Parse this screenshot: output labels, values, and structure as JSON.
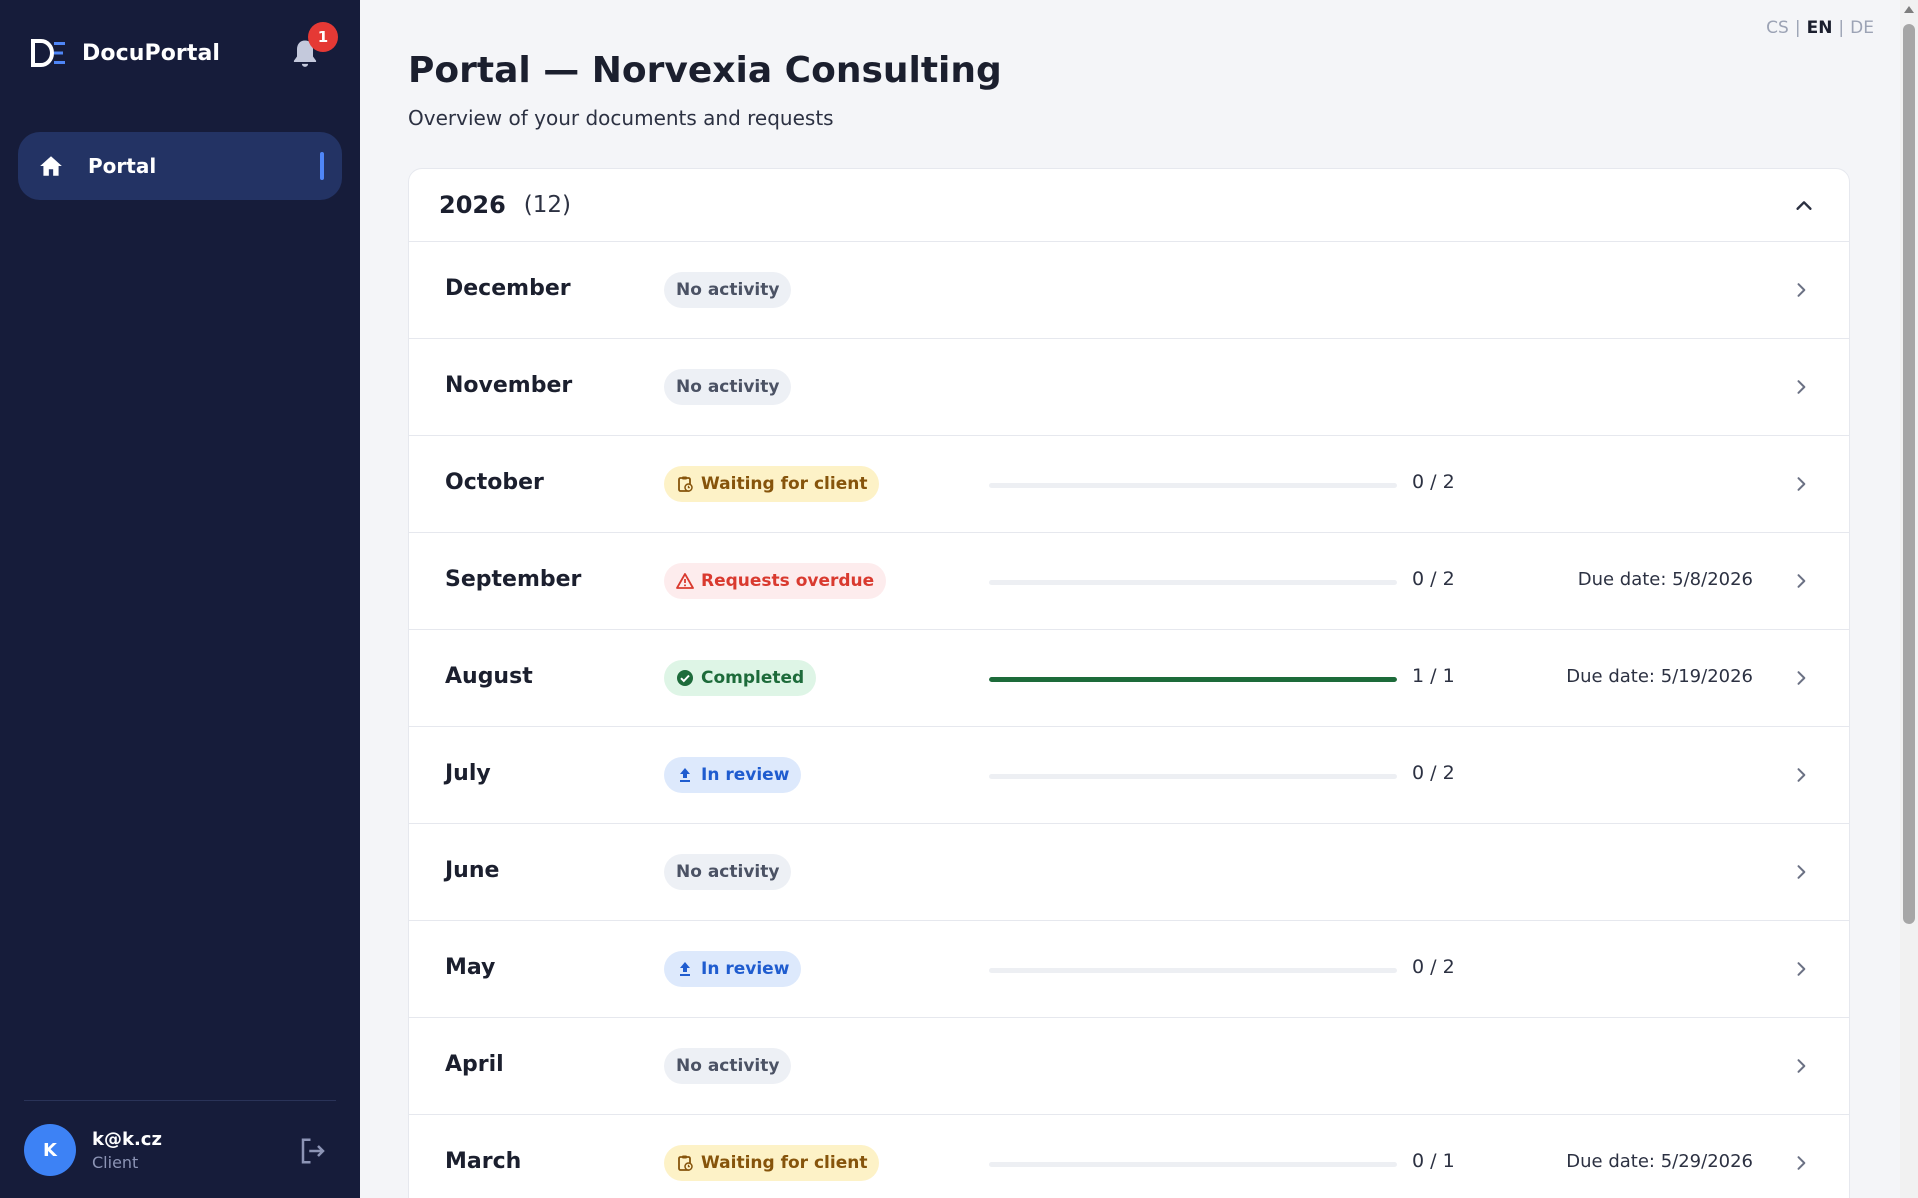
{
  "app": {
    "name": "DocuPortal"
  },
  "notifications": {
    "count": "1"
  },
  "nav": {
    "items": [
      {
        "label": "Portal",
        "icon": "home-icon"
      }
    ]
  },
  "user": {
    "initial": "K",
    "email": "k@k.cz",
    "role": "Client"
  },
  "languages": [
    {
      "code": "CS",
      "active": false
    },
    {
      "code": "EN",
      "active": true
    },
    {
      "code": "DE",
      "active": false
    }
  ],
  "page": {
    "title": "Portal — Norvexia Consulting",
    "subtitle": "Overview of your documents and requests"
  },
  "year_group": {
    "year": "2026",
    "count": "(12)",
    "expanded": true
  },
  "colors": {
    "sidebar": "#161c3a",
    "nav_active": "#233364",
    "accent": "#3d82f5",
    "badge_red": "#e53935",
    "progress_green": "#1d6b3a"
  },
  "months": [
    {
      "name": "December",
      "status": "No activity",
      "status_type": "none"
    },
    {
      "name": "November",
      "status": "No activity",
      "status_type": "none"
    },
    {
      "name": "October",
      "status": "Waiting for client",
      "status_type": "waiting",
      "progress_text": "0 / 2",
      "progress": 0
    },
    {
      "name": "September",
      "status": "Requests overdue",
      "status_type": "overdue",
      "progress_text": "0 / 2",
      "progress": 0,
      "due": "Due date: 5/8/2026"
    },
    {
      "name": "August",
      "status": "Completed",
      "status_type": "completed",
      "progress_text": "1 / 1",
      "progress": 1,
      "due": "Due date: 5/19/2026"
    },
    {
      "name": "July",
      "status": "In review",
      "status_type": "review",
      "progress_text": "0 / 2",
      "progress": 0
    },
    {
      "name": "June",
      "status": "No activity",
      "status_type": "none"
    },
    {
      "name": "May",
      "status": "In review",
      "status_type": "review",
      "progress_text": "0 / 2",
      "progress": 0
    },
    {
      "name": "April",
      "status": "No activity",
      "status_type": "none"
    },
    {
      "name": "March",
      "status": "Waiting for client",
      "status_type": "waiting",
      "progress_text": "0 / 1",
      "progress": 0,
      "due": "Due date: 5/29/2026"
    }
  ]
}
